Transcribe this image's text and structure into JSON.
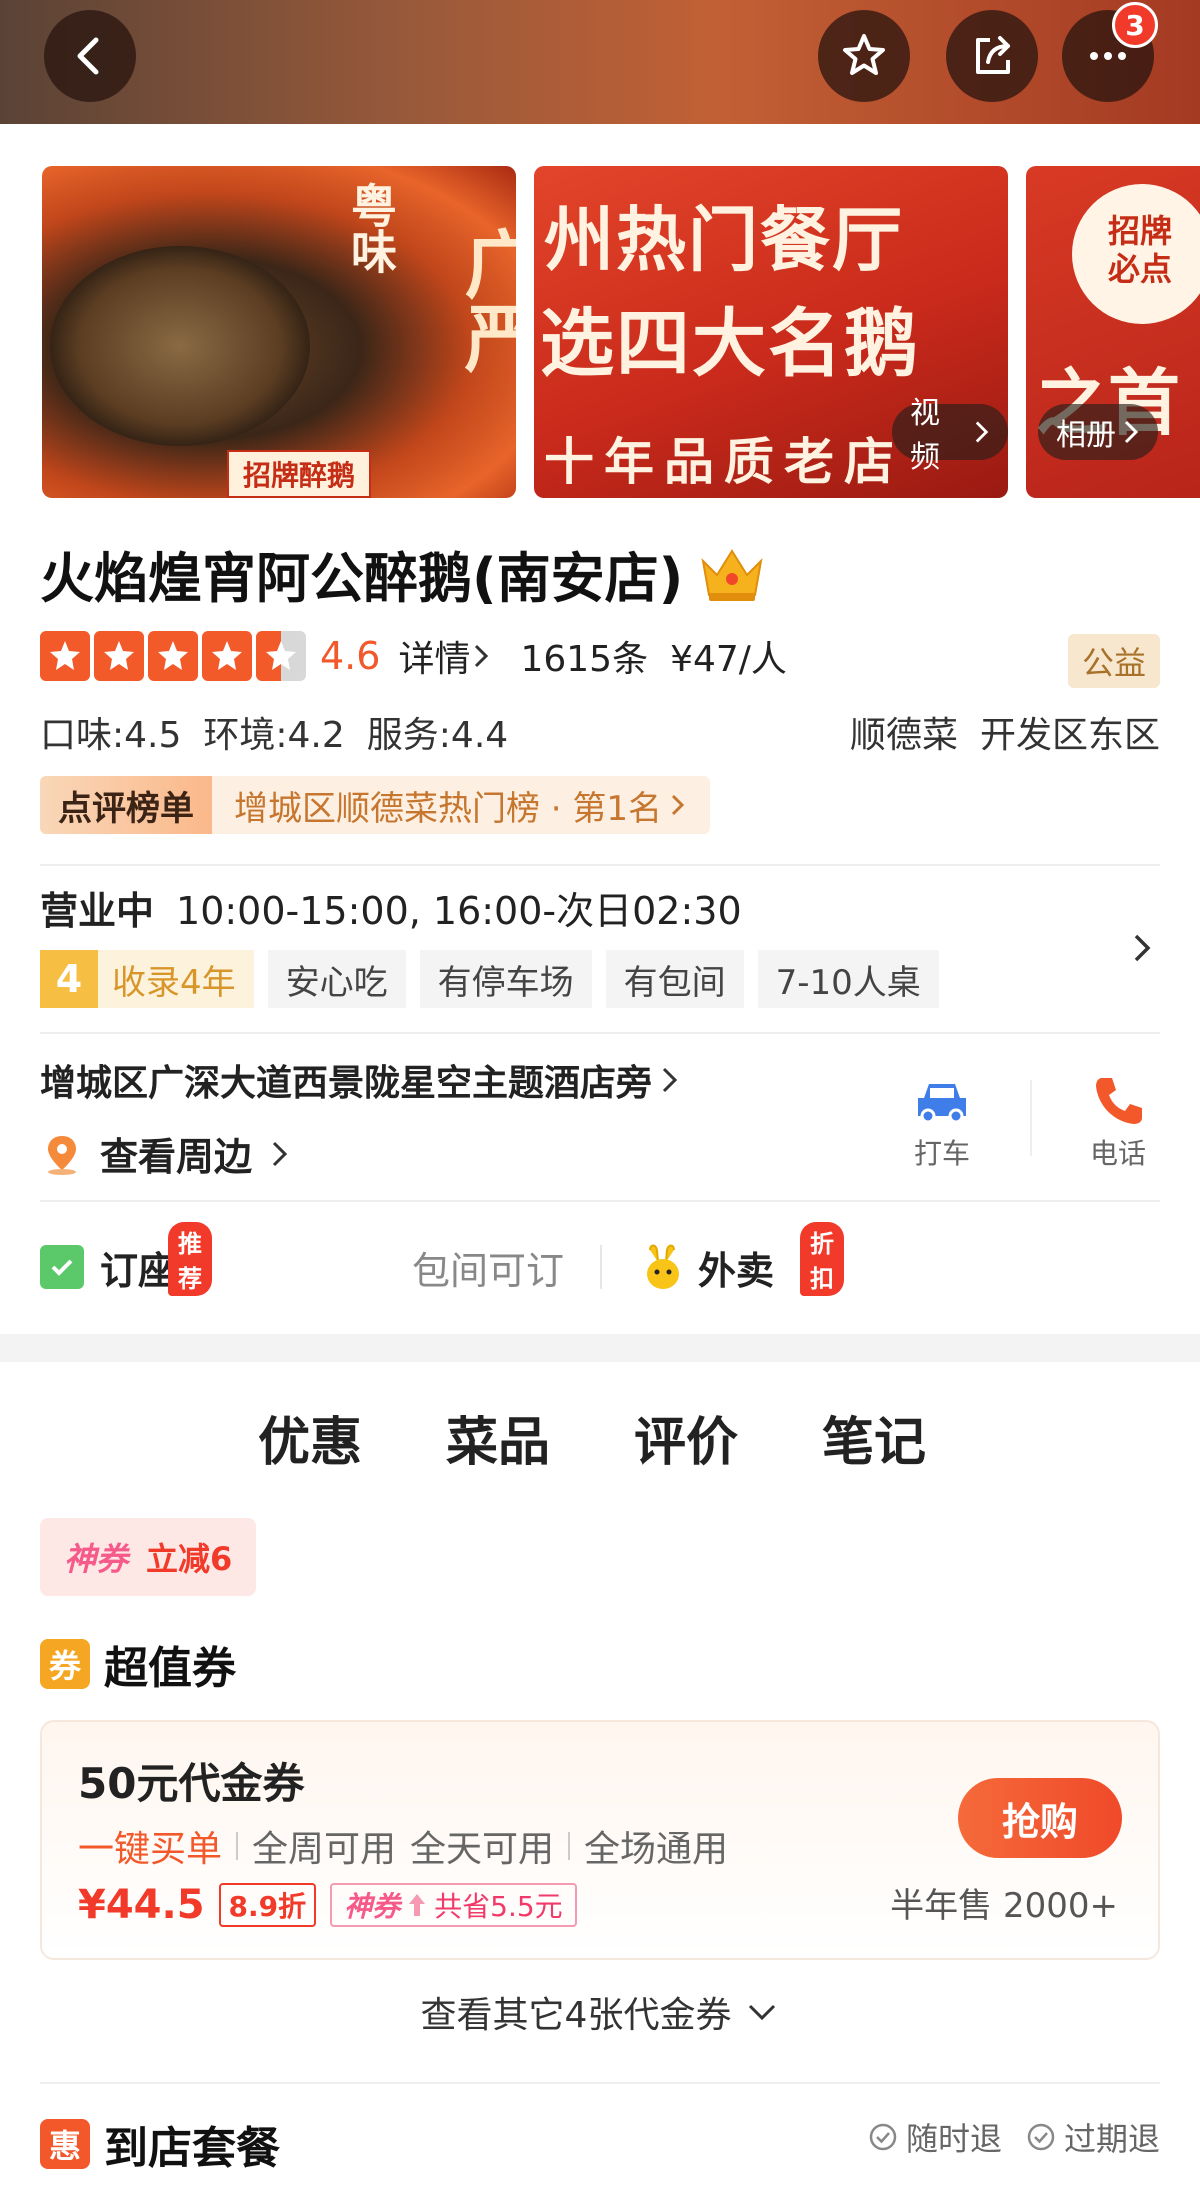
{
  "header": {
    "more_count": "3"
  },
  "gallery": {
    "photo1_brush": "粤味",
    "photo1_big": "广严",
    "photo1_seal": "招牌醉鹅",
    "photo2_line1": "州热门餐厅",
    "photo2_line2": "选四大名鹅",
    "photo2_line3": "十年品质老店",
    "photo3_line1": "招牌必点",
    "photo3_line2": "之首",
    "video_label": "视频",
    "album_label": "相册"
  },
  "shop": {
    "name": "火焰煌宵阿公醉鹅(南安店)",
    "rating": "4.6",
    "detail_label": "详情",
    "review_count": "1615条",
    "avg_price": "¥47/人",
    "charity_tag": "公益",
    "scores": [
      "口味:4.5",
      "环境:4.2",
      "服务:4.4"
    ],
    "cuisine": "顺德菜",
    "district": "开发区东区",
    "rank_tag": "点评榜单",
    "rank_text": "增城区顺德菜热门榜 · 第1名"
  },
  "hours": {
    "status": "营业中",
    "time": "10:00-15:00, 16:00-次日02:30",
    "years_num": "4",
    "years_label": "收录4年",
    "tags": [
      "安心吃",
      "有停车场",
      "有包间",
      "7-10人桌"
    ]
  },
  "address": {
    "text": "增城区广深大道西景陇星空主题酒店旁",
    "nearby": "查看周边",
    "taxi": "打车",
    "phone": "电话"
  },
  "booking": {
    "reserve": "订座",
    "reserve_badge": "推荐",
    "room_hint": "包间可订",
    "takeaway": "外卖",
    "takeaway_badge": "折扣"
  },
  "tabs": [
    "优惠",
    "菜品",
    "评价",
    "笔记"
  ],
  "deals": {
    "shenquan": "神券",
    "shenquan_value": "立减6",
    "section_icon": "券",
    "section_title": "超值券",
    "voucher": {
      "title": "50元代金券",
      "attr_highlight": "一键买单",
      "attrs": [
        "全周可用",
        "全天可用",
        "全场通用"
      ],
      "price": "¥44.5",
      "discount": "8.9折",
      "save_label": "神券",
      "save_text": "共省5.5元",
      "button": "抢购",
      "sold": "半年售 2000+"
    },
    "more": "查看其它4张代金券",
    "package_icon": "惠",
    "package_title": "到店套餐",
    "refund_any": "随时退",
    "refund_expired": "过期退"
  }
}
